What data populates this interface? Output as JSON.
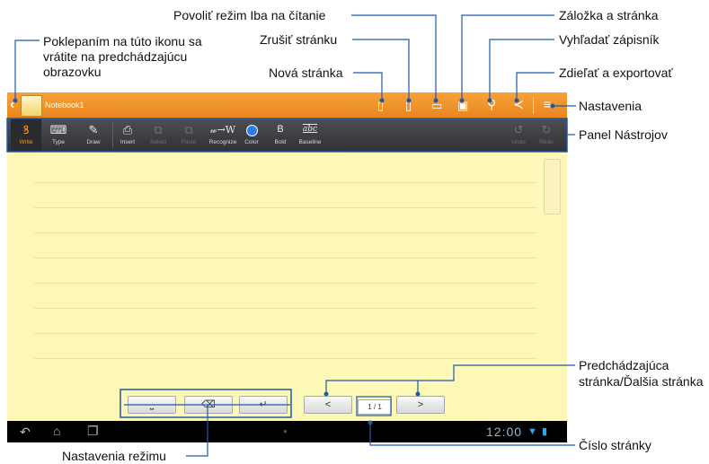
{
  "callouts": {
    "back": "Poklepaním na túto ikonu sa vrátite na predchádzajúcu obrazovku",
    "read_only": "Povoliť režim Iba na čítanie",
    "delete_page": "Zrušiť stránku",
    "new_page": "Nová stránka",
    "bookmark": "Záložka a stránka",
    "search": "Vyhľadať zápisník",
    "share": "Zdieľať a exportovať",
    "settings": "Nastavenia",
    "toolbar": "Panel Nástrojov",
    "prev_next": "Predchádzajúca stránka/Ďalšia stránka",
    "page_number": "Číslo stránky",
    "mode_settings": "Nastavenia režimu"
  },
  "app": {
    "notebook_title": "Notebook1"
  },
  "toolbar": {
    "tools": [
      {
        "label": "Write",
        "icon": "write-icon",
        "state": "selected"
      },
      {
        "label": "Type",
        "icon": "keyboard-icon",
        "state": "normal"
      },
      {
        "label": "Draw",
        "icon": "brush-icon",
        "state": "normal"
      },
      {
        "label": "Insert",
        "icon": "insert-icon",
        "state": "normal"
      },
      {
        "label": "Select",
        "icon": "select-icon",
        "state": "disabled"
      },
      {
        "label": "Paste",
        "icon": "paste-icon",
        "state": "disabled"
      },
      {
        "label": "Recognize",
        "icon": "recognize-icon",
        "state": "normal",
        "glyph": "𝓌→W"
      },
      {
        "label": "Color",
        "icon": "color-icon",
        "state": "normal"
      },
      {
        "label": "Bold",
        "icon": "bold-icon",
        "state": "normal",
        "glyph": "B"
      },
      {
        "label": "Baseline",
        "icon": "baseline-icon",
        "state": "normal",
        "glyph": "abc"
      },
      {
        "label": "Undo",
        "icon": "undo-icon",
        "state": "disabled"
      },
      {
        "label": "Redo",
        "icon": "redo-icon",
        "state": "disabled"
      }
    ]
  },
  "pager": {
    "prev": "<",
    "next": ">",
    "page_indicator": "1  /  1"
  },
  "statusbar": {
    "time": "12:00"
  },
  "colors": {
    "title_bar": "#f0931f",
    "toolbar": "#3a3c40",
    "paper": "#fdf7b8",
    "callout_line": "#1e5aa8",
    "selected_tool": "#f39a25",
    "color_dot": "#2f7fe8"
  }
}
